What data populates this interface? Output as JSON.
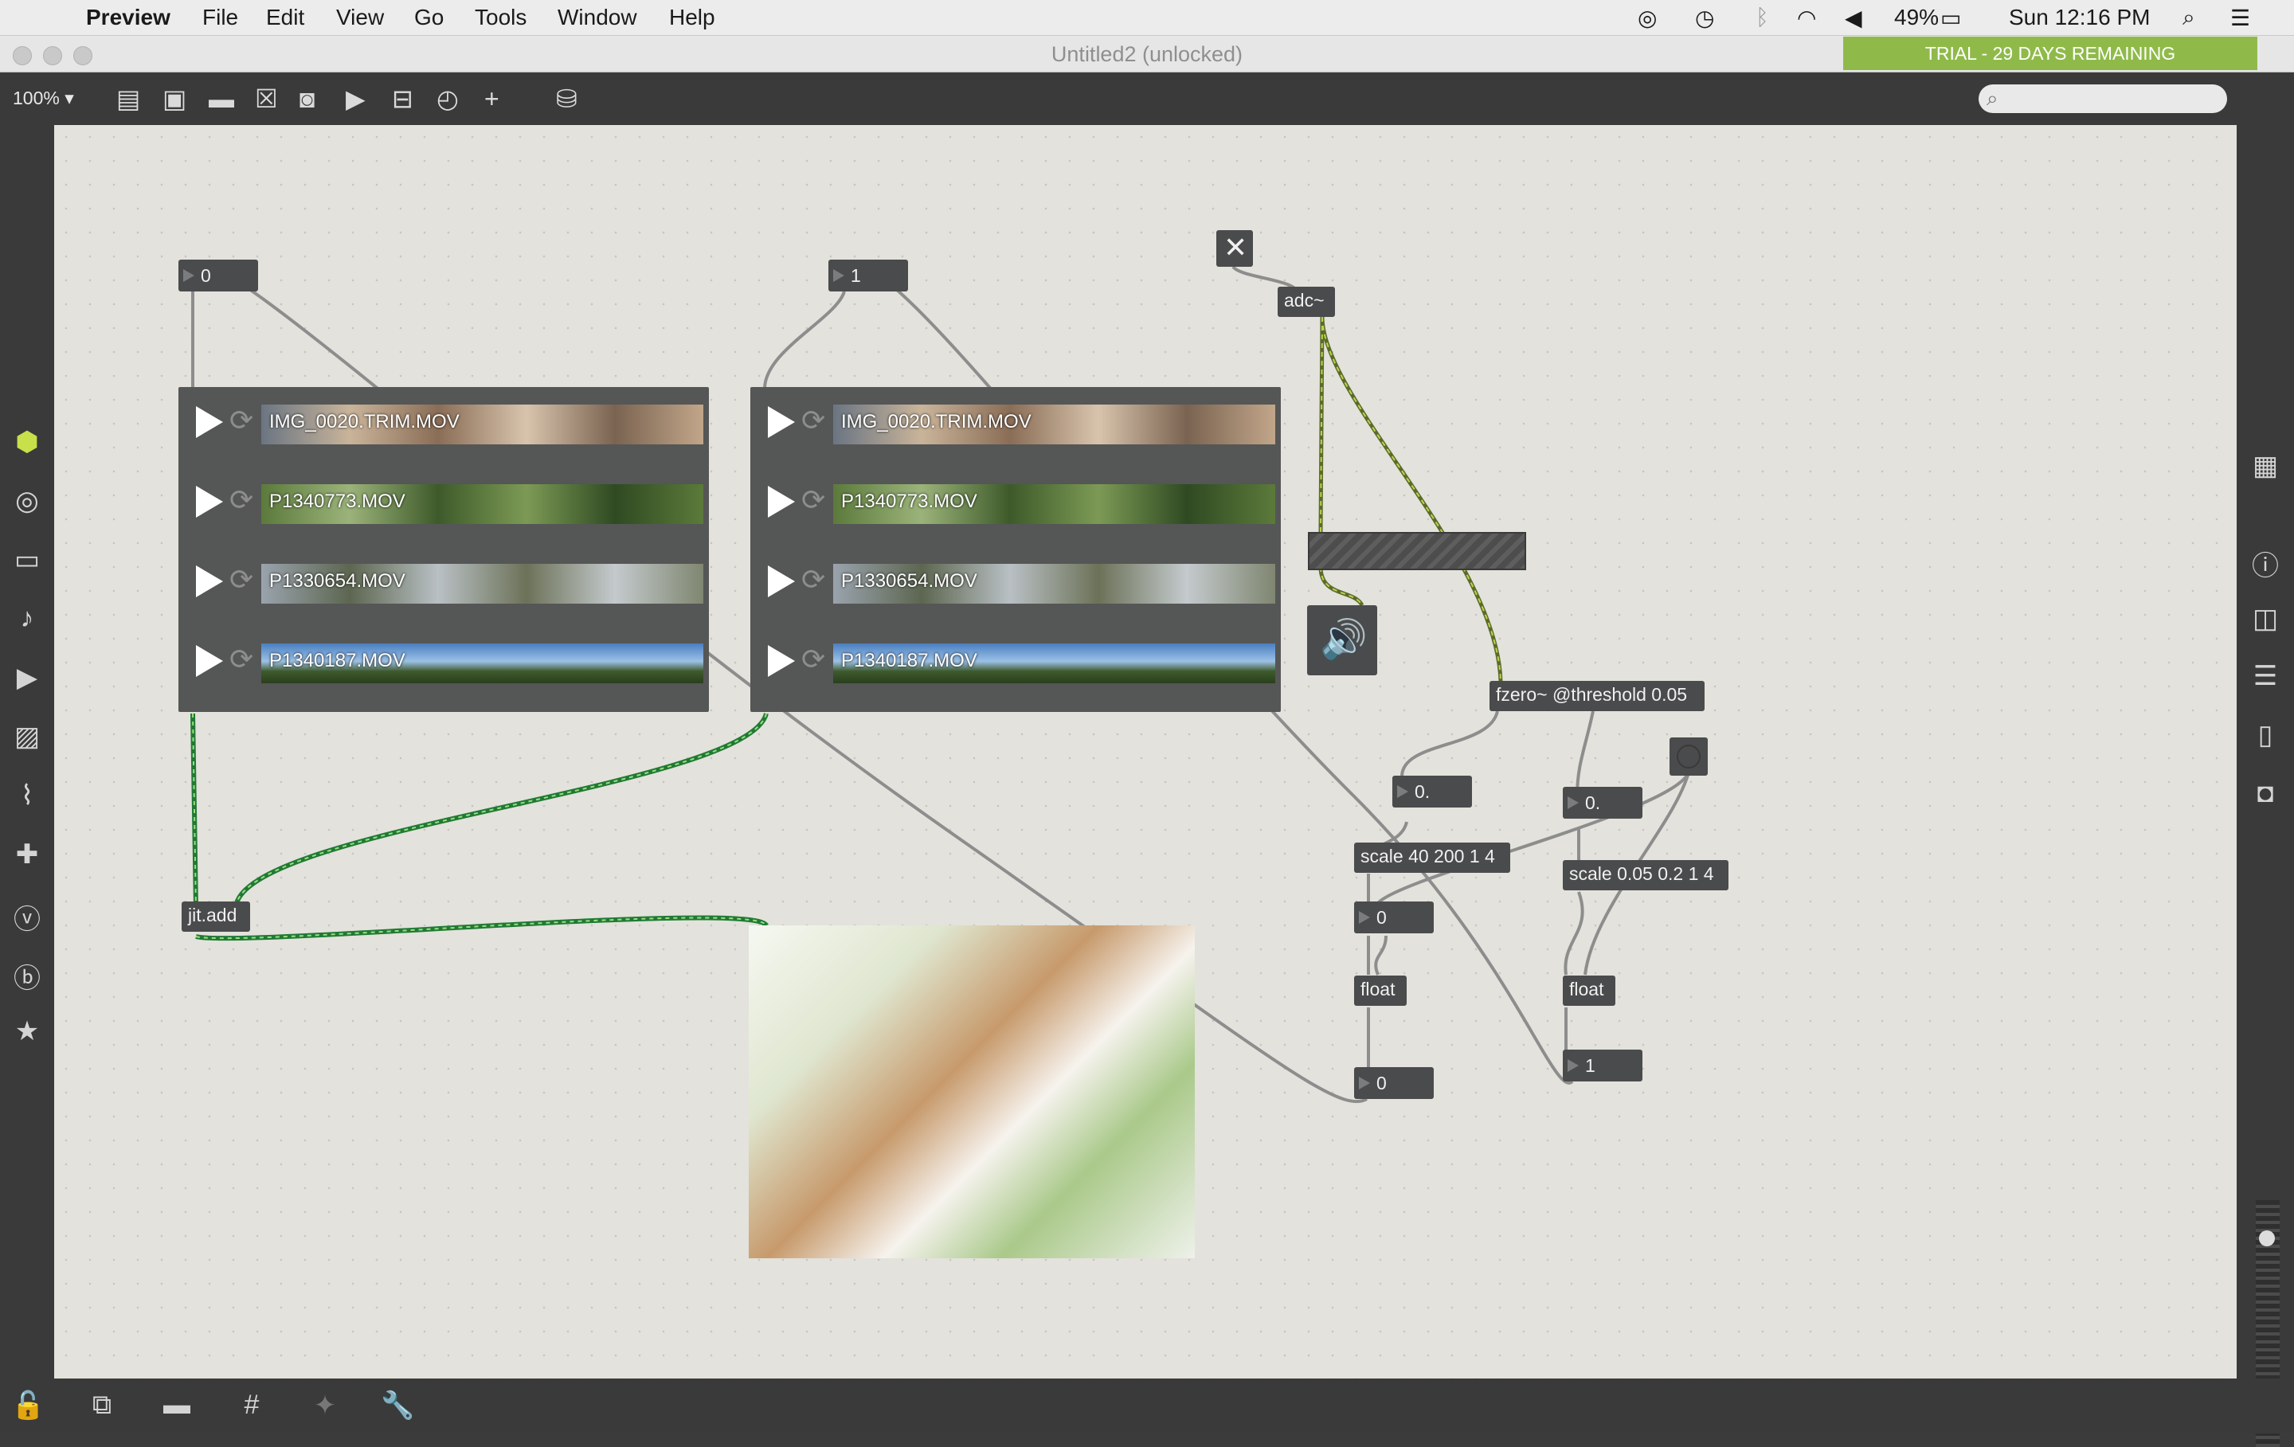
{
  "menubar": {
    "app": "Preview",
    "menus": [
      "File",
      "Edit",
      "View",
      "Go",
      "Tools",
      "Window",
      "Help"
    ],
    "battery": "49%",
    "clock": "Sun 12:16 PM"
  },
  "window": {
    "title": "Untitled2 (unlocked)",
    "trial_banner": "TRIAL - 29 DAYS REMAINING"
  },
  "toolbar": {
    "zoom": "100%",
    "zoom_arrow": "▾",
    "search_placeholder": ""
  },
  "patch": {
    "number_boxes": {
      "top_left": "0",
      "top_mid": "1",
      "fzero_out": "0.",
      "fzero_out2": "0.",
      "scale1_out": "0",
      "float1_out": "0",
      "float2_out": "1"
    },
    "objects": {
      "adc": "adc~",
      "fzero": "fzero~ @threshold 0.05",
      "scale1": "scale 40 200 1 4",
      "scale2": "scale 0.05 0.2 1 4",
      "float1": "float",
      "float2": "float",
      "jitadd": "jit.add"
    },
    "playlist_left": [
      "IMG_0020.TRIM.MOV",
      "P1340773.MOV",
      "P1330654.MOV",
      "P1340187.MOV"
    ],
    "playlist_right": [
      "IMG_0020.TRIM.MOV",
      "P1340773.MOV",
      "P1330654.MOV",
      "P1340187.MOV"
    ],
    "toggle_glyph": "✕",
    "speaker_glyph": "🔊"
  },
  "colors": {
    "canvas": "#e3e2dc",
    "object_bg": "#4a4b4c",
    "trial": "#8fba49",
    "signal_cord": "#b8d44a",
    "matrix_cord": "#1f7a36"
  }
}
